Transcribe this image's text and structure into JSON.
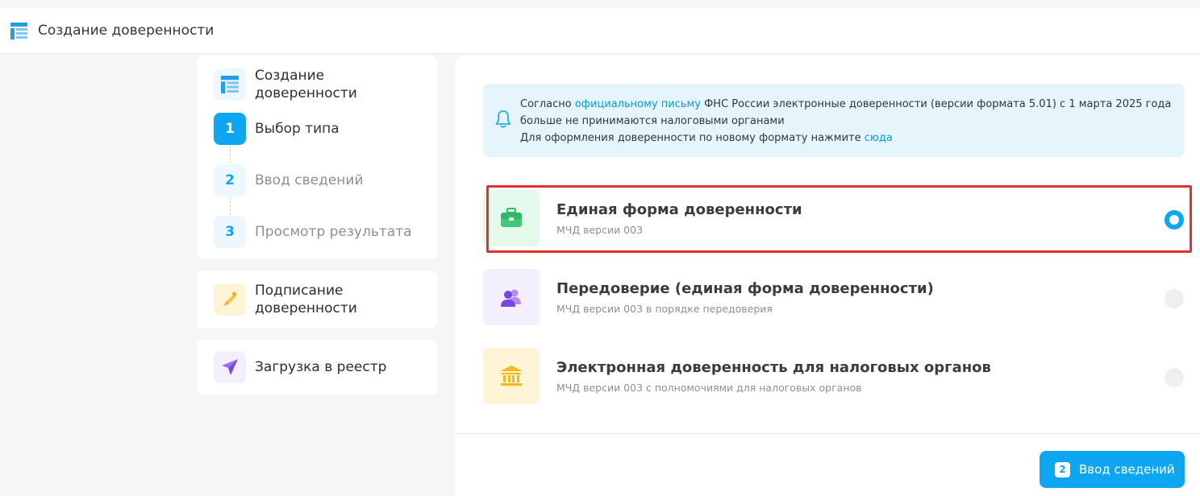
{
  "header": {
    "title": "Создание доверенности",
    "icon": "form-icon"
  },
  "sidebar": {
    "create": {
      "title": "Создание доверенности",
      "steps": [
        {
          "number": "1",
          "label": "Выбор типа",
          "state": "active"
        },
        {
          "number": "2",
          "label": "Ввод сведений",
          "state": "inactive"
        },
        {
          "number": "3",
          "label": "Просмотр результата",
          "state": "inactive"
        }
      ]
    },
    "sign": {
      "title": "Подписание доверенности",
      "icon": "pen-icon"
    },
    "upload": {
      "title": "Загрузка в реестр",
      "icon": "paper-plane-icon"
    }
  },
  "notice": {
    "icon": "bell-icon",
    "p1_before": "Согласно ",
    "p1_link": "официальному письму",
    "p1_after": " ФНС России электронные доверенности (версии формата 5.01) с 1 марта 2025 года больше не принимаются налоговыми органами",
    "p2_before": "Для оформления доверенности по новому формату нажмите ",
    "p2_link": "сюда"
  },
  "options": [
    {
      "title": "Единая форма доверенности",
      "subtitle": "МЧД версии 003",
      "icon": "briefcase-icon",
      "selected": true
    },
    {
      "title": "Передоверие (единая форма доверенности)",
      "subtitle": "МЧД версии 003 в порядке передоверия",
      "icon": "users-icon",
      "selected": false
    },
    {
      "title": "Электронная доверенность для налоговых органов",
      "subtitle": "МЧД версии 003 с полномочиями для налоговых органов",
      "icon": "bank-icon",
      "selected": false
    }
  ],
  "footer": {
    "button_number": "2",
    "button_label": "Ввод сведений"
  },
  "colors": {
    "accent": "#0ea5f1",
    "highlight": "#e2302f",
    "link": "#0b96e0"
  }
}
